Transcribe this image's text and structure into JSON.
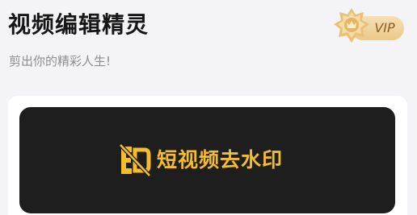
{
  "header": {
    "app_title": "视频编辑精灵",
    "subtitle": "剪出你的精彩人生!"
  },
  "vip": {
    "label": "VIP",
    "icon": "vip-crown-emblem-icon"
  },
  "main": {
    "action_label": "短视频去水印",
    "action_icon": "watermark-remove-icon"
  },
  "colors": {
    "background": "#f4f4f6",
    "card": "#ffffff",
    "button": "#1e1e1e",
    "accent": "#f5bd2a",
    "vip_gold": "#ecc98a"
  }
}
